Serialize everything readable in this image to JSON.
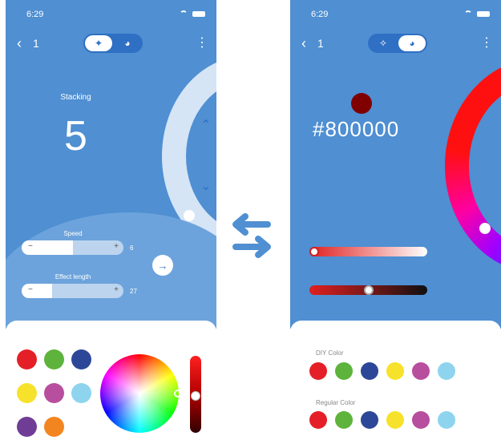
{
  "colors": {
    "primary": "#4f8fd2",
    "dark": "#2f6fc4",
    "light_wave": "#6da3dc",
    "dial": "#d5e5f6",
    "selected_color": "#800000"
  },
  "status": {
    "time": "6:29",
    "wifi_icon": "wifi-icon",
    "battery_icon": "battery-icon"
  },
  "nav": {
    "back_icon": "chevron-left-icon",
    "count": "1",
    "more_icon": "more-vertical-icon",
    "tab_effects_icon": "sparkle-icon",
    "tab_palette_icon": "palette-icon"
  },
  "left": {
    "stacking_label": "Stacking",
    "stacking_value": "5",
    "up_icon": "chevron-up-icon",
    "down_icon": "chevron-down-icon",
    "speed": {
      "label": "Speed",
      "value": "6",
      "fraction": 0.5,
      "minus": "−",
      "plus": "+"
    },
    "effect_length": {
      "label": "Effect length",
      "value": "27",
      "fraction": 0.3,
      "minus": "−",
      "plus": "+"
    },
    "next_icon": "arrow-right-icon",
    "swatches": [
      "#e41f27",
      "#5db33b",
      "#2d4798",
      "#f7e22b",
      "#b84e9e",
      "#8ed4ee",
      "#6f3d96",
      "#f28520"
    ],
    "brightness_fraction": 0.5
  },
  "swap_icon": "swap-arrows-icon",
  "right": {
    "hex": "#800000",
    "red_slider_fraction": 0.0,
    "brightness_slider_fraction": 0.5,
    "diy_label": "DIY Color",
    "regular_label": "Regular Color",
    "diy_colors": [
      "#e41f27",
      "#5db33b",
      "#2d4798",
      "#f7e22b",
      "#b84e9e",
      "#8ed4ee"
    ],
    "regular_colors": [
      "#e41f27",
      "#5db33b",
      "#2d4798",
      "#f7e22b",
      "#b84e9e",
      "#8ed4ee"
    ]
  }
}
